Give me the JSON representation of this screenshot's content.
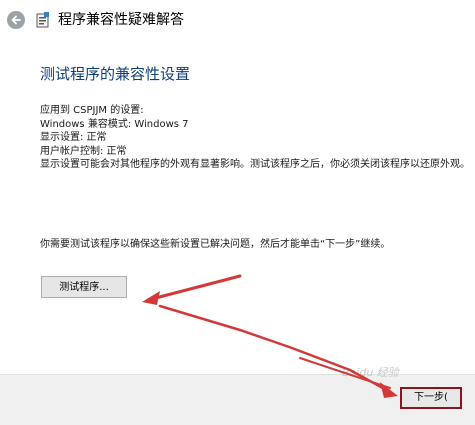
{
  "window": {
    "title": "程序兼容性疑难解答",
    "back_icon": "back-arrow-icon",
    "app_icon": "wizard-icon"
  },
  "main": {
    "heading": "测试程序的兼容性设置",
    "settings": {
      "applied_to": "应用到  CSPJJM 的设置:",
      "compat_mode": "Windows 兼容模式: Windows 7",
      "display": "显示设置: 正常",
      "uac": "用户帐户控制: 正常",
      "note": "显示设置可能会对其他程序的外观有显著影响。测试该程序之后，你必须关闭该程序以还原外观。"
    },
    "instruction": "你需要测试该程序以确保这些新设置已解决问题，然后才能单击“下一步”继续。",
    "test_button": "测试程序..."
  },
  "footer": {
    "next_button": "下一步(",
    "watermark": "Baidu 经验"
  },
  "colors": {
    "heading": "#0f3f7a",
    "annotation_arrow": "#d23a3a",
    "highlight_border": "#8a1520"
  }
}
